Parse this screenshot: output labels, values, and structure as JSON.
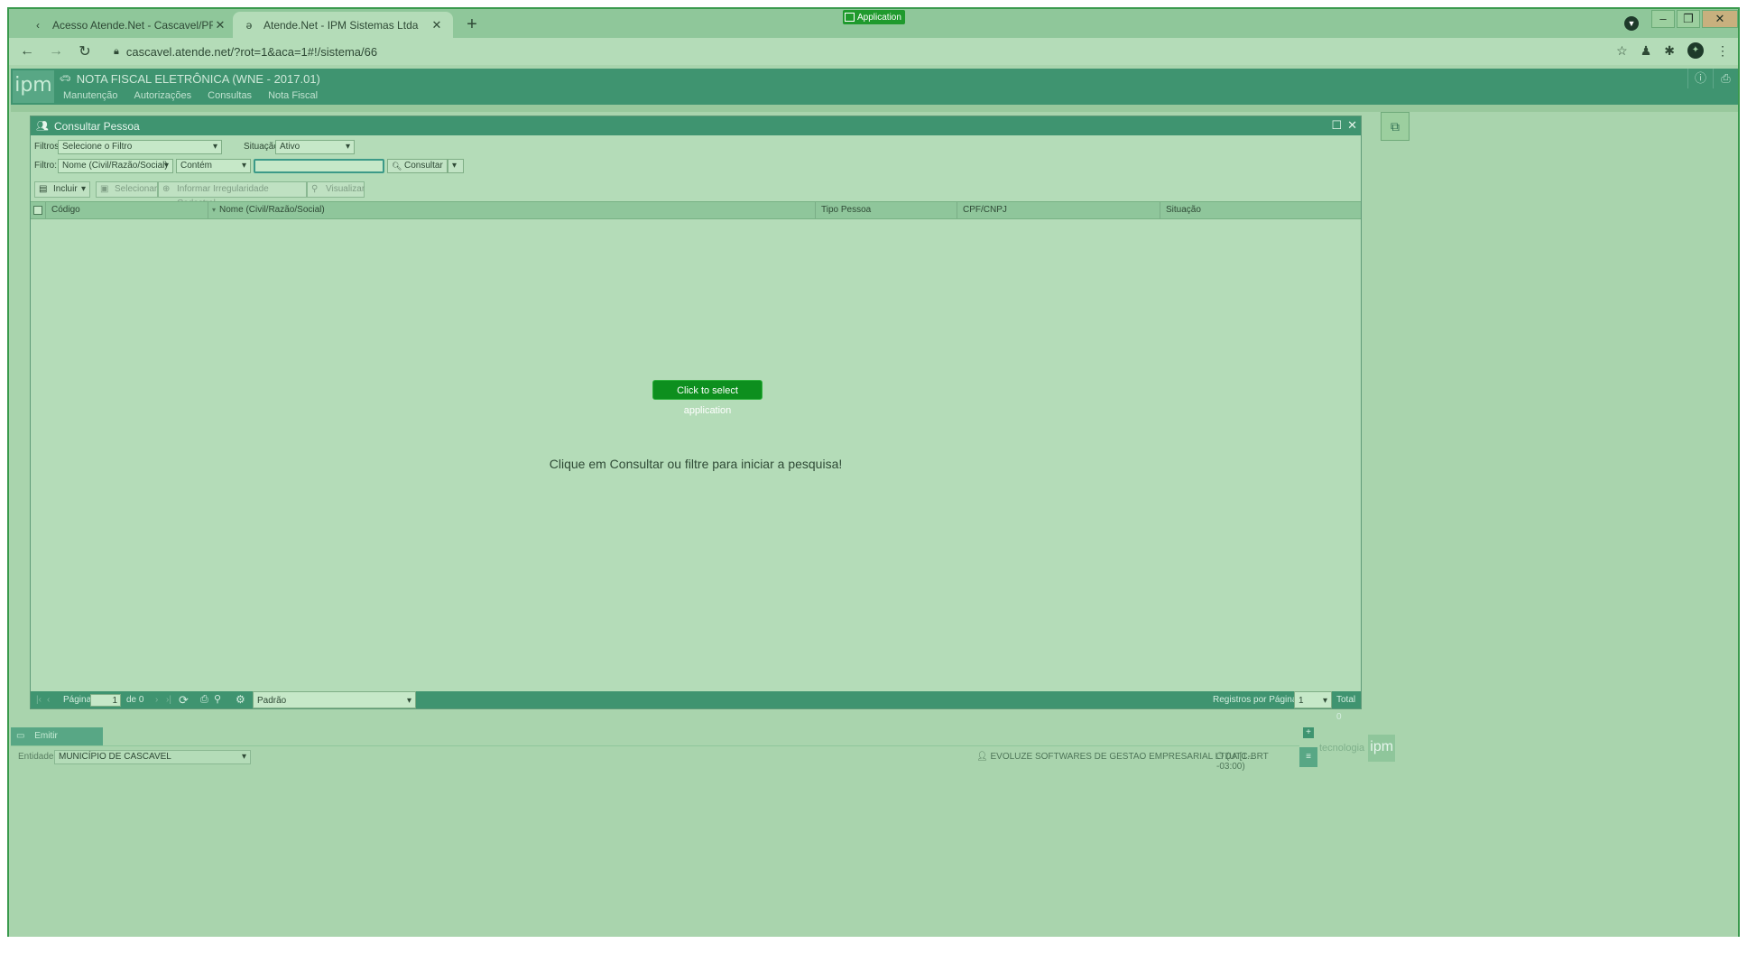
{
  "browser": {
    "tabs": [
      {
        "title": "Acesso Atende.Net - Cascavel/PR",
        "active": false
      },
      {
        "title": "Atende.Net - IPM Sistemas Ltda",
        "active": true
      }
    ],
    "new_tab": "+",
    "app_badge": "Application",
    "url": "cascavel.atende.net/?rot=1&aca=1#!/sistema/66",
    "window_controls": {
      "minimize": "–",
      "restore": "❐",
      "close": "✕"
    }
  },
  "app": {
    "logo": "ipm",
    "title": "NOTA FISCAL ELETRÔNICA (WNE - 2017.01)",
    "menu": [
      "Manutenção",
      "Autorizações",
      "Consultas",
      "Nota Fiscal"
    ]
  },
  "window": {
    "title": "Consultar Pessoa",
    "filters": {
      "filtros_label": "Filtros",
      "filtros_value": "Selecione o Filtro",
      "situacao_label": "Situação",
      "situacao_value": "Ativo",
      "filtro_label": "Filtro:",
      "field_value": "Nome (Civil/Razão/Social)",
      "operator_value": "Contém",
      "search_value": "",
      "consultar_label": "Consultar"
    },
    "actions": {
      "incluir": "Incluir",
      "selecionar": "Selecionar",
      "informar": "Informar Irregularidade Cadastral",
      "visualizar": "Visualizar"
    },
    "grid": {
      "columns": [
        "Código",
        "Nome (Civil/Razão/Social)",
        "Tipo Pessoa",
        "CPF/CNPJ",
        "Situação"
      ],
      "empty_message": "Clique em Consultar ou filtre para iniciar a pesquisa!"
    },
    "select_application": "Click to select application",
    "pager": {
      "pagina_label": "Página",
      "page": "1",
      "de_label": "de 0",
      "layout_value": "Padrão",
      "registros_label": "Registros por Página",
      "registros_value": "1",
      "total_label": "Total 0"
    }
  },
  "bottom": {
    "tab_label": "Emitir",
    "entidades_label": "Entidades",
    "entidade_value": "MUNICÍPIO DE CASCAVEL",
    "user": "EVOLUZE SOFTWARES DE GESTAO EMPRESARIAL LTDA [1...",
    "timezone": "(UTC-BRT -03:00)",
    "brand_text": "tecnologia",
    "brand_logo": "ipm"
  }
}
